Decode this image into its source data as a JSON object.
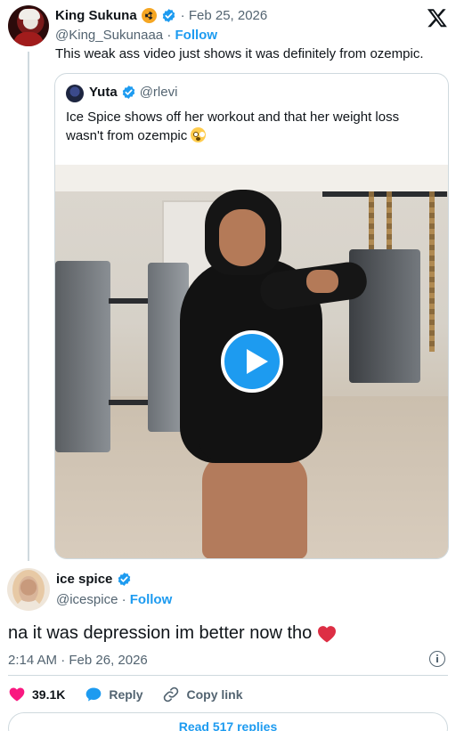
{
  "top_tweet": {
    "display_name": "King Sukuna",
    "date": "· Feb 25, 2026",
    "handle": "@King_Sukunaaa",
    "follow_sep": " · ",
    "follow_label": "Follow",
    "text": "This weak ass video just shows it was definitely from ozempic.",
    "icons": [
      "radiation-emoji",
      "verified-badge",
      "x-logo"
    ]
  },
  "quote": {
    "display_name": "Yuta",
    "handle": "@rlevi",
    "text": "Ice Spice shows off her workout and that her weight loss wasn't from ozempic",
    "emoji": "flushed-face",
    "media": "video",
    "play_icon": "play-icon"
  },
  "reply": {
    "display_name": "ice spice",
    "handle": "@icespice",
    "follow_sep": " · ",
    "follow_label": "Follow",
    "text": "na it was depression im better now tho",
    "emoji": "red-heart",
    "timestamp": "2:14 AM · Feb 26, 2026"
  },
  "actions": {
    "like_count": "39.1K",
    "reply_label": "Reply",
    "copy_label": "Copy link"
  },
  "footer": {
    "read_replies": "Read 517 replies"
  },
  "colors": {
    "accent": "#1d9bf0",
    "text": "#0f1419",
    "muted": "#536471",
    "border": "#cfd9de",
    "like": "#f91880"
  }
}
